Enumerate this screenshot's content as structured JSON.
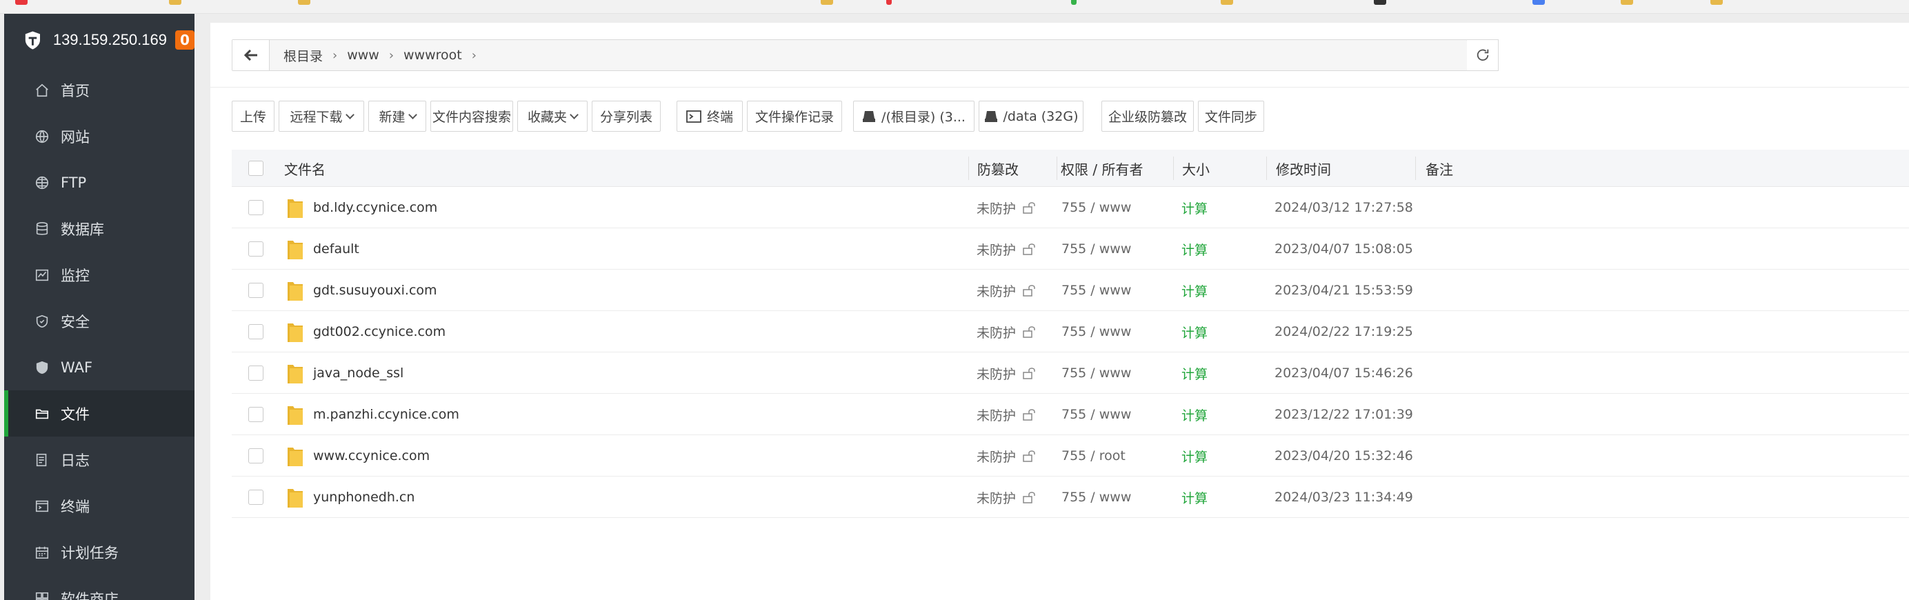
{
  "server": {
    "ip": "139.159.250.169",
    "badge": "0"
  },
  "nav": [
    {
      "label": "首页",
      "icon": "home-icon",
      "active": false
    },
    {
      "label": "网站",
      "icon": "globe-icon",
      "active": false
    },
    {
      "label": "FTP",
      "icon": "ftp-globe-icon",
      "active": false
    },
    {
      "label": "数据库",
      "icon": "database-icon",
      "active": false
    },
    {
      "label": "监控",
      "icon": "monitor-icon",
      "active": false
    },
    {
      "label": "安全",
      "icon": "shield-icon",
      "active": false
    },
    {
      "label": "WAF",
      "icon": "waf-shield-icon",
      "active": false
    },
    {
      "label": "文件",
      "icon": "folder-icon",
      "active": true
    },
    {
      "label": "日志",
      "icon": "log-icon",
      "active": false
    },
    {
      "label": "终端",
      "icon": "terminal-icon",
      "active": false
    },
    {
      "label": "计划任务",
      "icon": "calendar-icon",
      "active": false
    },
    {
      "label": "软件商店",
      "icon": "store-icon",
      "active": false
    }
  ],
  "breadcrumb": [
    "根目录",
    "www",
    "wwwroot"
  ],
  "toolbar": {
    "upload": "上传",
    "remote_download": "远程下载",
    "new": "新建",
    "content_search": "文件内容搜索",
    "favorites": "收藏夹",
    "share_list": "分享列表",
    "terminal": "终端",
    "file_log": "文件操作记录",
    "disk_root": "/(根目录) (3...",
    "disk_data": "/data (32G)",
    "tamper": "企业级防篡改",
    "sync": "文件同步"
  },
  "table": {
    "headers": {
      "name": "文件名",
      "protect": "防篡改",
      "perm": "权限 / 所有者",
      "size": "大小",
      "mtime": "修改时间",
      "note": "备注"
    },
    "rows": [
      {
        "name": "bd.ldy.ccynice.com",
        "protect": "未防护",
        "perm": "755 / www",
        "size": "计算",
        "mtime": "2024/03/12 17:27:58"
      },
      {
        "name": "default",
        "protect": "未防护",
        "perm": "755 / www",
        "size": "计算",
        "mtime": "2023/04/07 15:08:05"
      },
      {
        "name": "gdt.susuyouxi.com",
        "protect": "未防护",
        "perm": "755 / www",
        "size": "计算",
        "mtime": "2023/04/21 15:53:59"
      },
      {
        "name": "gdt002.ccynice.com",
        "protect": "未防护",
        "perm": "755 / www",
        "size": "计算",
        "mtime": "2024/02/22 17:19:25"
      },
      {
        "name": "java_node_ssl",
        "protect": "未防护",
        "perm": "755 / www",
        "size": "计算",
        "mtime": "2023/04/07 15:46:26"
      },
      {
        "name": "m.panzhi.ccynice.com",
        "protect": "未防护",
        "perm": "755 / www",
        "size": "计算",
        "mtime": "2023/12/22 17:01:39"
      },
      {
        "name": "www.ccynice.com",
        "protect": "未防护",
        "perm": "755 / root",
        "size": "计算",
        "mtime": "2023/04/20 15:32:46"
      },
      {
        "name": "yunphonedh.cn",
        "protect": "未防护",
        "perm": "755 / www",
        "size": "计算",
        "mtime": "2024/03/23 11:34:49"
      }
    ]
  },
  "colors": {
    "accent": "#20a53a",
    "sidebar": "#30363d",
    "badge": "#f26e0f",
    "folder": "#f7c948"
  }
}
